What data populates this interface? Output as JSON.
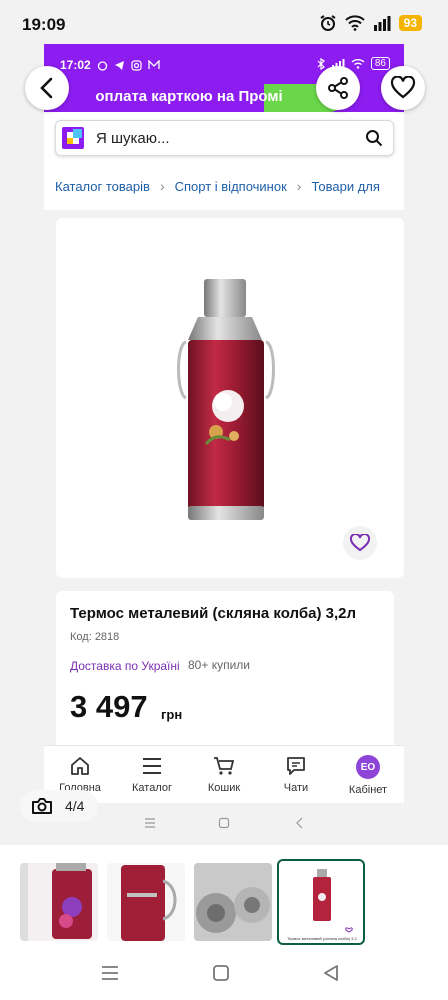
{
  "status_bar": {
    "time": "19:09",
    "battery": "93"
  },
  "inner_status": {
    "time": "17:02",
    "battery": "86"
  },
  "banner": {
    "text": "оплата карткою на Промі"
  },
  "search": {
    "placeholder": "Я шукаю..."
  },
  "breadcrumb": [
    "Каталог товарів",
    "Спорт і відпочинок",
    "Товари для"
  ],
  "product": {
    "title": "Термос металевий (скляна колба) 3,2л",
    "code": "Код: 2818",
    "delivery": "Доставка по Україні",
    "bought": "80+ купили",
    "price": "3 497",
    "currency": "грн"
  },
  "bottom_nav": [
    {
      "label": "Головна",
      "icon": "home-icon"
    },
    {
      "label": "Каталог",
      "icon": "menu-icon"
    },
    {
      "label": "Кошик",
      "icon": "cart-icon"
    },
    {
      "label": "Чати",
      "icon": "chat-icon"
    },
    {
      "label": "Кабінет",
      "icon": "avatar",
      "initials": "ЕО"
    }
  ],
  "gallery": {
    "counter": "4/4",
    "selected_index": 3,
    "thumb_caption": "Термос металевий (скляна колба) 3,2л"
  },
  "colors": {
    "brand_purple": "#8c1cf0",
    "accent_green": "#6ad64a",
    "link_blue": "#1f5fa8",
    "thermos_red": "#b3243c"
  }
}
